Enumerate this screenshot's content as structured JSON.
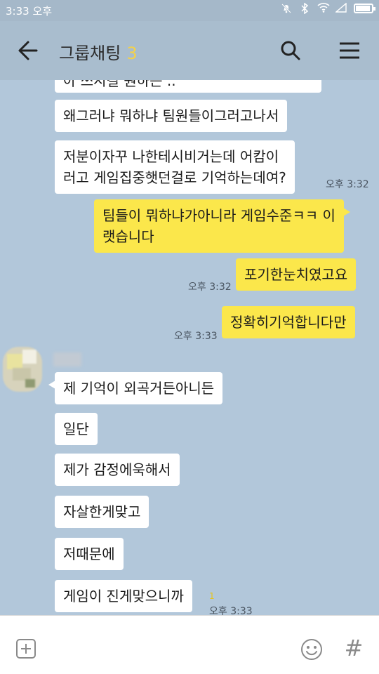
{
  "status_bar": {
    "time": "3:33 오후",
    "icons": [
      "bell-off-icon",
      "bluetooth-icon",
      "wifi-icon",
      "signal-icon",
      "battery-icon"
    ]
  },
  "header": {
    "title": "그룹채팅",
    "member_count": "3"
  },
  "messages": [
    {
      "side": "left",
      "text": "아 쓰시길 원하는 ..",
      "partial": true
    },
    {
      "side": "left",
      "text": "왜그러냐 뭐하냐 팀원들이그러고나서"
    },
    {
      "side": "left",
      "lines": [
        "저분이자꾸 나한테시비거는데 어캄이",
        "러고 게임집중햇던걸로 기억하는데여?"
      ],
      "time": "오후 3:32"
    },
    {
      "side": "right",
      "lines": [
        "팀들이 뭐하냐가아니라 게임수준ㅋㅋ 이",
        "랫습니다"
      ]
    },
    {
      "side": "right",
      "text": "포기한눈치였고요",
      "time": "오후 3:32"
    },
    {
      "side": "right",
      "text": "정확히기억합니다만",
      "time": "오후 3:33"
    },
    {
      "side": "left",
      "text": "제 기억이 외곡거든아니든"
    },
    {
      "side": "left",
      "text": "일단"
    },
    {
      "side": "left",
      "text": "제가 감정에욱해서"
    },
    {
      "side": "left",
      "text": "자살한게맞고"
    },
    {
      "side": "left",
      "text": "저때문에"
    },
    {
      "side": "left",
      "text": "게임이 진게맞으니까",
      "time": "오후 3:33",
      "unread": "1"
    }
  ],
  "colors": {
    "chat_bg": "#b2c7da",
    "my_bubble": "#fbe74b",
    "their_bubble": "#ffffff",
    "header_bg": "#a9bdce",
    "count_accent": "#f4d24a"
  },
  "input_bar": {
    "add_icon": "plus-square-icon",
    "emoji_icon": "smiley-icon",
    "hash_label": "#"
  }
}
